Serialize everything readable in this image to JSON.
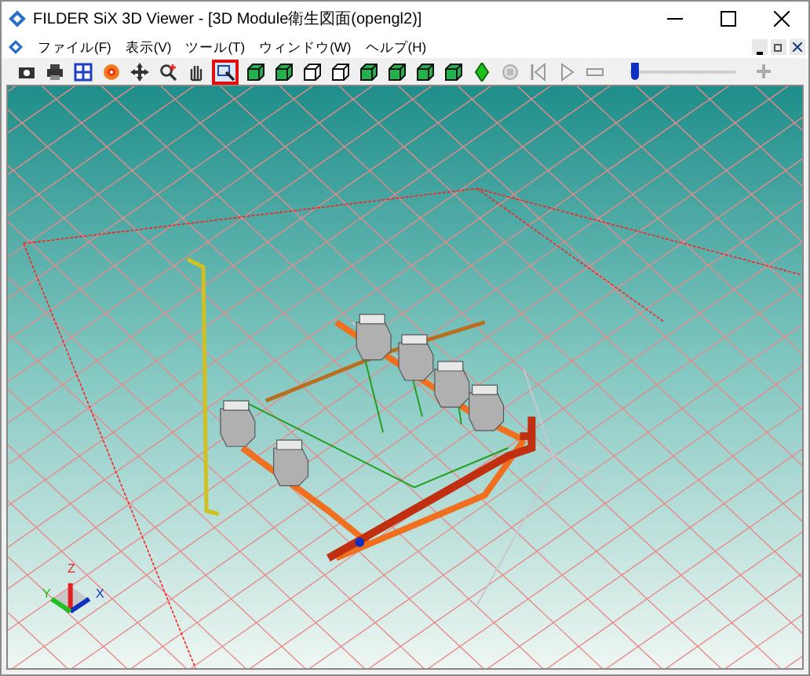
{
  "window": {
    "title": "FILDER SiX 3D Viewer - [3D Module衛生図面(opengl2)]"
  },
  "menu": [
    "ファイル(F)",
    "表示(V)",
    "ツール(T)",
    "ウィンドウ(W)",
    "ヘルプ(H)"
  ],
  "toolbar": [
    {
      "kind": "camera",
      "selected": false
    },
    {
      "kind": "print",
      "selected": false
    },
    {
      "kind": "grid",
      "selected": false
    },
    {
      "kind": "palette",
      "selected": false
    },
    {
      "kind": "move",
      "selected": false
    },
    {
      "kind": "zoom-in",
      "selected": false
    },
    {
      "kind": "pan",
      "selected": false
    },
    {
      "kind": "zoom-window",
      "selected": true
    },
    {
      "kind": "solid",
      "selected": false
    },
    {
      "kind": "solid",
      "selected": false
    },
    {
      "kind": "wire",
      "selected": false
    },
    {
      "kind": "wire",
      "selected": false
    },
    {
      "kind": "solid",
      "selected": false
    },
    {
      "kind": "solid",
      "selected": false
    },
    {
      "kind": "solid",
      "selected": false
    },
    {
      "kind": "solid",
      "selected": false
    },
    {
      "kind": "diamond",
      "selected": false
    },
    {
      "kind": "record",
      "selected": false
    },
    {
      "kind": "first",
      "selected": false
    },
    {
      "kind": "play",
      "selected": false
    },
    {
      "kind": "minus",
      "selected": false
    }
  ],
  "slider": {
    "level": 0.05
  },
  "axes": {
    "x": "X",
    "y": "Y",
    "z": "Z"
  }
}
